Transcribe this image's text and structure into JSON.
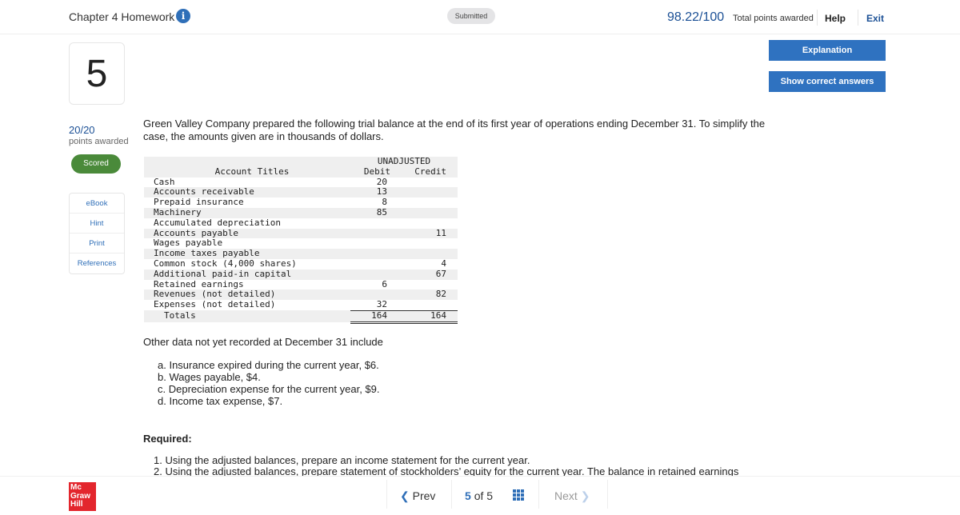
{
  "header": {
    "title": "Chapter 4 Homework",
    "status": "Submitted",
    "score": "98.22/100",
    "score_label": "Total points awarded",
    "help": "Help",
    "exit": "Exit"
  },
  "question": {
    "number": "5",
    "points": "20/20",
    "points_label": "points awarded",
    "badge": "Scored"
  },
  "actions": {
    "explanation": "Explanation",
    "show_answers": "Show correct answers"
  },
  "tools": [
    "eBook",
    "Hint",
    "Print",
    "References"
  ],
  "prompt": "Green Valley Company prepared the following trial balance at the end of its first year of operations ending December 31. To simplify the case, the amounts given are in thousands of dollars.",
  "trial_balance": {
    "group_header": "UNADJUSTED",
    "columns": [
      "Account Titles",
      "Debit",
      "Credit"
    ],
    "rows": [
      [
        "Cash",
        "20",
        ""
      ],
      [
        "Accounts receivable",
        "13",
        ""
      ],
      [
        "Prepaid insurance",
        "8",
        ""
      ],
      [
        "Machinery",
        "85",
        ""
      ],
      [
        "Accumulated depreciation",
        "",
        ""
      ],
      [
        "Accounts payable",
        "",
        "11"
      ],
      [
        "Wages payable",
        "",
        ""
      ],
      [
        "Income taxes payable",
        "",
        ""
      ],
      [
        "Common stock (4,000 shares)",
        "",
        "4"
      ],
      [
        "Additional paid-in capital",
        "",
        "67"
      ],
      [
        "Retained earnings",
        "6",
        ""
      ],
      [
        "Revenues (not detailed)",
        "",
        "82"
      ],
      [
        "Expenses (not detailed)",
        "32",
        ""
      ]
    ],
    "totals": [
      "Totals",
      "164",
      "164"
    ]
  },
  "other_data": {
    "intro": "Other data not yet recorded at December 31 include",
    "items": [
      "a. Insurance expired during the current year, $6.",
      "b. Wages payable, $4.",
      "c. Depreciation expense for the current year, $9.",
      "d. Income tax expense, $7."
    ]
  },
  "required": {
    "label": "Required:",
    "items": [
      "1. Using the adjusted balances, prepare an income statement for the current year.",
      "2. Using the adjusted balances, prepare statement of stockholders’ equity for the current year. The balance in retained earnings"
    ]
  },
  "footer": {
    "logo": "Mc Graw Hill",
    "prev": "Prev",
    "current": "5",
    "of": "of",
    "total": "5",
    "next": "Next"
  }
}
